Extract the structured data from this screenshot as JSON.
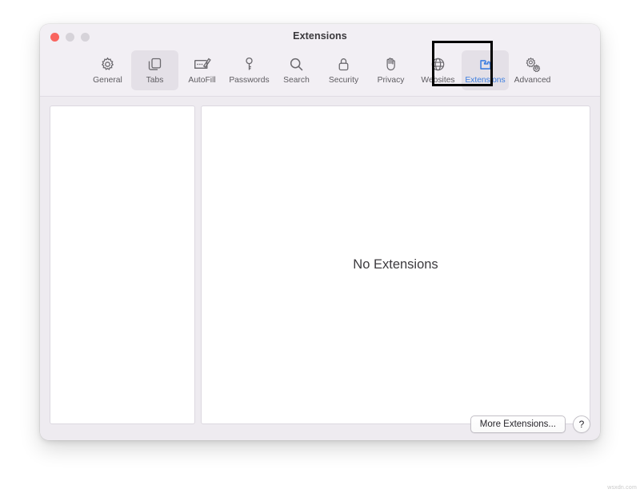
{
  "window": {
    "title": "Extensions",
    "traffic_lights": [
      {
        "name": "close",
        "color": "#f9655f"
      },
      {
        "name": "minimize",
        "color": "#d6d3d9"
      },
      {
        "name": "zoom",
        "color": "#d6d3d9"
      }
    ]
  },
  "toolbar": {
    "items": [
      {
        "label": "General",
        "icon": "gear-icon",
        "state": "normal"
      },
      {
        "label": "Tabs",
        "icon": "tabs-icon",
        "state": "hovered"
      },
      {
        "label": "AutoFill",
        "icon": "autofill-icon",
        "state": "normal"
      },
      {
        "label": "Passwords",
        "icon": "key-icon",
        "state": "normal"
      },
      {
        "label": "Search",
        "icon": "search-icon",
        "state": "normal"
      },
      {
        "label": "Security",
        "icon": "lock-icon",
        "state": "normal"
      },
      {
        "label": "Privacy",
        "icon": "hand-icon",
        "state": "normal"
      },
      {
        "label": "Websites",
        "icon": "globe-icon",
        "state": "normal"
      },
      {
        "label": "Extensions",
        "icon": "puzzle-icon",
        "state": "selected"
      },
      {
        "label": "Advanced",
        "icon": "gears-icon",
        "state": "normal"
      }
    ],
    "selected_accent": "#3e7fe0",
    "annotation_color": "#000000"
  },
  "main": {
    "extension_list": {
      "items": []
    },
    "empty_message": "No Extensions"
  },
  "footer": {
    "more_extensions_label": "More Extensions...",
    "help_label": "?"
  },
  "watermark": "wsxdn.com"
}
